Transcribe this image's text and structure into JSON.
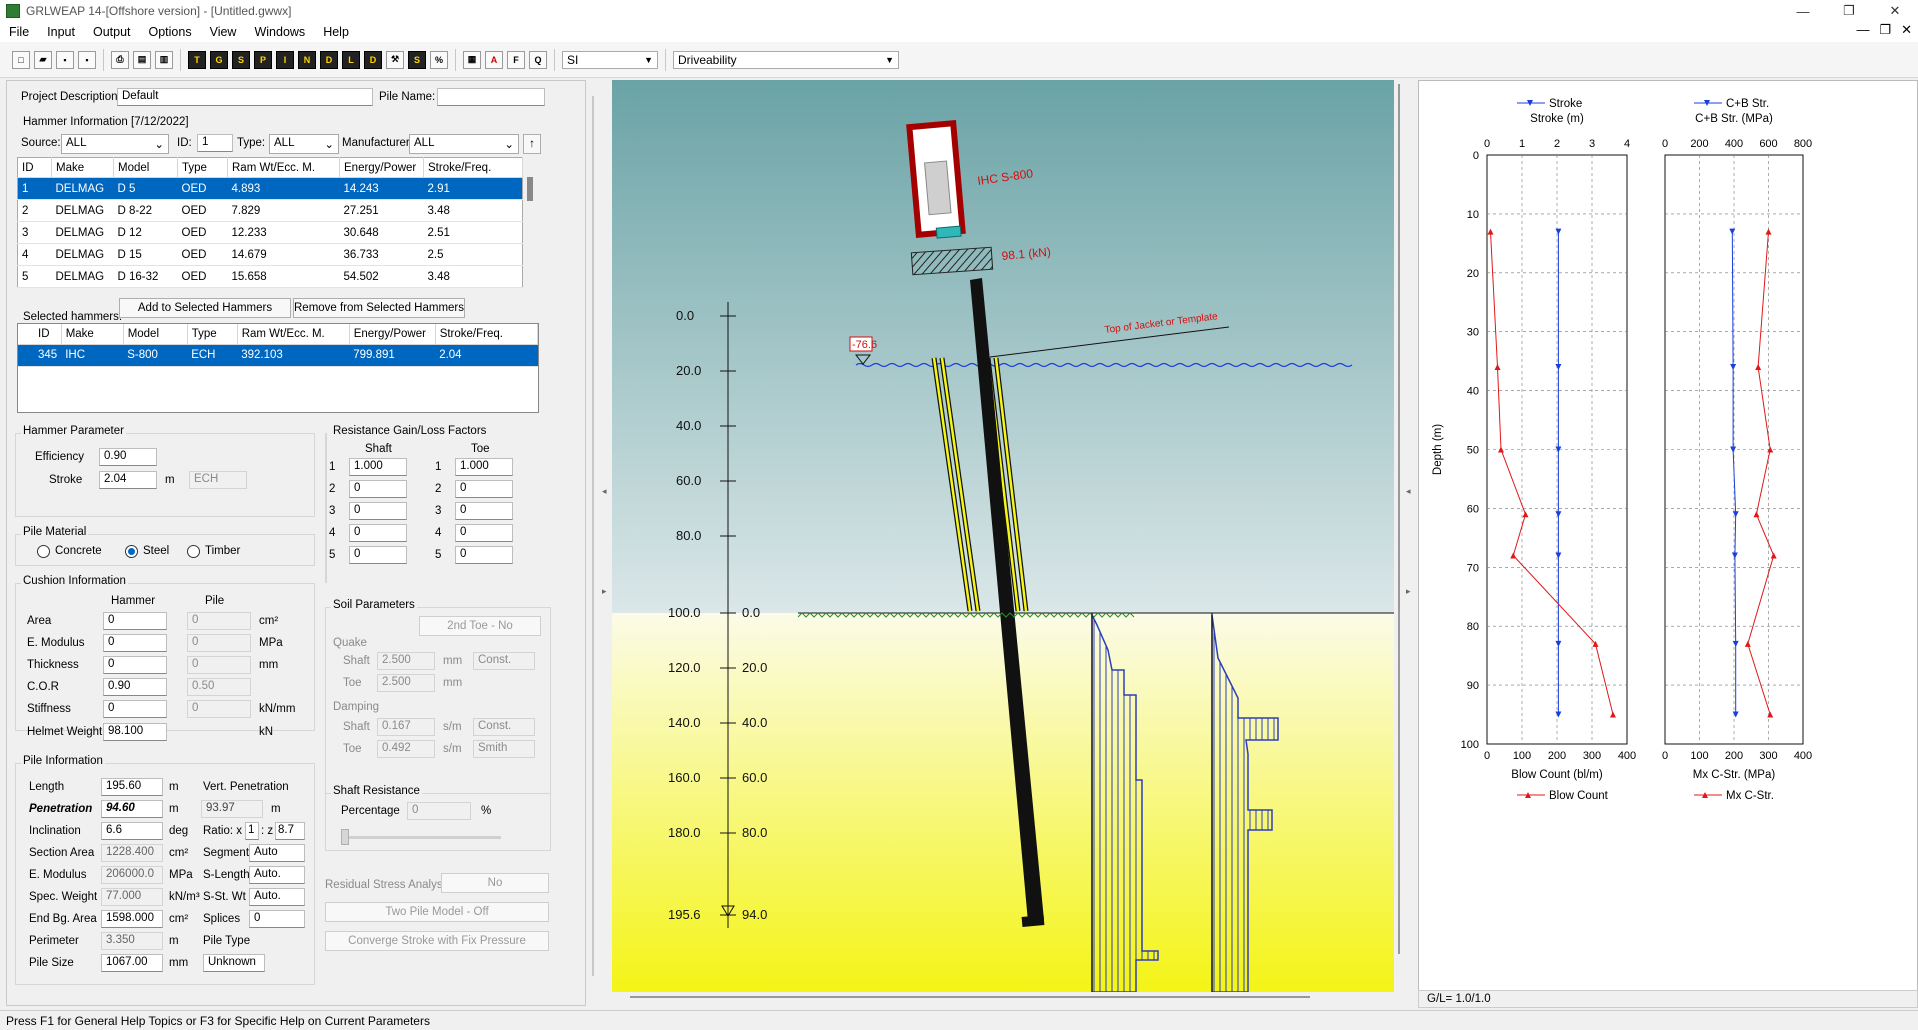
{
  "window": {
    "title": "GRLWEAP 14-[Offshore version]  - [Untitled.gwwx]",
    "min": "—",
    "max": "❐",
    "close": "✕"
  },
  "menu": [
    "File",
    "Input",
    "Output",
    "Options",
    "View",
    "Windows",
    "Help"
  ],
  "toolbar": {
    "units": "SI",
    "mode": "Driveability"
  },
  "status": "Press F1 for General Help Topics or F3 for Specific Help on Current Parameters",
  "project": {
    "desc_label": "Project Description:",
    "desc_value": "Default",
    "pile_name_label": "Pile Name:",
    "pile_name_value": ""
  },
  "hammer_info": {
    "title": "Hammer Information [7/12/2022]",
    "source_label": "Source:",
    "source": "ALL",
    "id_label": "ID:",
    "id": "1",
    "type_label": "Type:",
    "type": "ALL",
    "manufacturer_label": "Manufacturer:",
    "manufacturer": "ALL",
    "headers": [
      "ID",
      "Make",
      "Model",
      "Type",
      "Ram Wt/Ecc. M.",
      "Energy/Power",
      "Stroke/Freq."
    ],
    "rows": [
      [
        "1",
        "DELMAG",
        "D 5",
        "OED",
        "4.893",
        "14.243",
        "2.91"
      ],
      [
        "2",
        "DELMAG",
        "D 8-22",
        "OED",
        "7.829",
        "27.251",
        "3.48"
      ],
      [
        "3",
        "DELMAG",
        "D 12",
        "OED",
        "12.233",
        "30.648",
        "2.51"
      ],
      [
        "4",
        "DELMAG",
        "D 15",
        "OED",
        "14.679",
        "36.733",
        "2.5"
      ],
      [
        "5",
        "DELMAG",
        "D 16-32",
        "OED",
        "15.658",
        "54.502",
        "3.48"
      ]
    ]
  },
  "selected": {
    "label": "Selected hammers:",
    "add_btn": "Add to Selected Hammers",
    "remove_btn": "Remove from Selected Hammers",
    "headers": [
      "ID",
      "Make",
      "Model",
      "Type",
      "Ram Wt/Ecc. M.",
      "Energy/Power",
      "Stroke/Freq."
    ],
    "rows": [
      [
        "345",
        "IHC",
        "S-800",
        "ECH",
        "392.103",
        "799.891",
        "2.04"
      ]
    ]
  },
  "hammer_param": {
    "title": "Hammer Parameter",
    "eff_label": "Efficiency",
    "eff": "0.90",
    "stroke_label": "Stroke",
    "stroke": "2.04",
    "stroke_unit": "m",
    "type": "ECH"
  },
  "pile_material": {
    "title": "Pile Material",
    "options": [
      "Concrete",
      "Steel",
      "Timber"
    ],
    "selected": "Steel"
  },
  "cushion": {
    "title": "Cushion Information",
    "col_hammer": "Hammer",
    "col_pile": "Pile",
    "rows": [
      {
        "label": "Area",
        "hammer": "0",
        "pile": "0",
        "unit": "cm²"
      },
      {
        "label": "E. Modulus",
        "hammer": "0",
        "pile": "0",
        "unit": "MPa"
      },
      {
        "label": "Thickness",
        "hammer": "0",
        "pile": "0",
        "unit": "mm"
      },
      {
        "label": "C.O.R",
        "hammer": "0.90",
        "pile": "0.50",
        "unit": ""
      },
      {
        "label": "Stiffness",
        "hammer": "0",
        "pile": "0",
        "unit": "kN/mm"
      }
    ],
    "helmet_label": "Helmet Weight",
    "helmet": "98.100",
    "helmet_unit": "kN"
  },
  "pile_info": {
    "title": "Pile Information",
    "length_label": "Length",
    "length": "195.60",
    "length_unit": "m",
    "vert_label": "Vert. Penetration",
    "pen_label": "Penetration",
    "pen": "94.60",
    "pen_unit": "m",
    "vert": "93.97",
    "vert_unit": "m",
    "incl_label": "Inclination",
    "incl": "6.6",
    "incl_unit": "deg",
    "ratio_label": "Ratio: x",
    "ratio_x": "1",
    "ratio_z_label": ": z",
    "ratio_z": "8.7",
    "area_label": "Section Area",
    "area": "1228.400",
    "area_unit": "cm²",
    "seg_label": "Segments",
    "seg": "Auto",
    "emod_label": "E. Modulus",
    "emod": "206000.0",
    "emod_unit": "MPa",
    "slen_label": "S-Length",
    "slen": "Auto.",
    "sw_label": "Spec. Weight",
    "sw": "77.000",
    "sw_unit": "kN/m³",
    "sst_label": "S-St. Wt",
    "sst": "Auto.",
    "eb_label": "End Bg. Area",
    "eb": "1598.000",
    "eb_unit": "cm²",
    "spl_label": "Splices",
    "spl": "0",
    "per_label": "Perimeter",
    "per": "3.350",
    "per_unit": "m",
    "ptype_label": "Pile Type",
    "size_label": "Pile Size",
    "size": "1067.00",
    "size_unit": "mm",
    "ptype": "Unknown"
  },
  "resistance": {
    "title": "Resistance Gain/Loss Factors",
    "shaft_label": "Shaft",
    "toe_label": "Toe",
    "shaft": [
      "1.000",
      "0",
      "0",
      "0",
      "0"
    ],
    "toe": [
      "1.000",
      "0",
      "0",
      "0",
      "0"
    ],
    "idx": [
      "1",
      "2",
      "3",
      "4",
      "5"
    ]
  },
  "soil": {
    "title": "Soil Parameters",
    "toe2": "2nd Toe - No",
    "quake_label": "Quake",
    "shaft_label": "Shaft",
    "toe_label": "Toe",
    "q_shaft": "2.500",
    "q_toe": "2.500",
    "q_unit": "mm",
    "q_method": "Const.",
    "damp_label": "Damping",
    "d_shaft": "0.167",
    "d_toe": "0.492",
    "d_unit": "s/m",
    "d_method_shaft": "Const.",
    "d_method_toe": "Smith"
  },
  "shaft_res": {
    "title": "Shaft Resistance",
    "pct_label": "Percentage",
    "pct": "0",
    "pct_unit": "%"
  },
  "buttons": {
    "residual_label": "Residual Stress Analysis",
    "residual": "No",
    "two_pile": "Two Pile Model - Off",
    "converge": "Converge Stroke with Fix Pressure"
  },
  "drawing": {
    "hammer_label": "IHC  S-800",
    "helmet_label": "98.1 (kN)",
    "jacket_label": "Top of Jacket or Template",
    "water_label": "-76.6",
    "left_ticks": [
      "0.0",
      "20.0",
      "40.0",
      "60.0",
      "80.0",
      "100.0",
      "120.0",
      "140.0",
      "160.0",
      "180.0",
      "195.6"
    ],
    "right_ticks": [
      "0.0",
      "20.0",
      "40.0",
      "60.0",
      "80.0",
      "94.0"
    ]
  },
  "charts": {
    "gl": "G/L= 1.0/1.0",
    "left": {
      "top_legend": "Stroke",
      "top_axis": "Stroke (m)",
      "top_ticks": [
        "0",
        "1",
        "2",
        "3",
        "4"
      ],
      "bottom_axis": "Blow Count (bl/m)",
      "bottom_ticks": [
        "0",
        "100",
        "200",
        "300",
        "400"
      ],
      "bottom_legend": "Blow Count",
      "y_label": "Depth (m)",
      "y_ticks": [
        "0",
        "10",
        "20",
        "30",
        "40",
        "50",
        "60",
        "70",
        "80",
        "90",
        "100"
      ]
    },
    "right": {
      "top_legend": "C+B Str.",
      "top_axis": "C+B Str. (MPa)",
      "top_ticks": [
        "0",
        "200",
        "400",
        "600",
        "800"
      ],
      "bottom_axis": "Mx C-Str. (MPa)",
      "bottom_ticks": [
        "0",
        "100",
        "200",
        "300",
        "400"
      ],
      "bottom_legend": "Mx C-Str."
    }
  },
  "chart_data": [
    {
      "type": "line",
      "y_axis": "Depth (m)",
      "ylim": [
        0,
        100
      ],
      "y_reversed": true,
      "series": [
        {
          "name": "Stroke",
          "axis": "top",
          "xlim": [
            0,
            4
          ],
          "color": "#1a3fdc",
          "x": [
            2.04,
            2.04,
            2.04,
            2.04,
            2.04,
            2.04,
            2.04
          ],
          "y": [
            13,
            36,
            50,
            61,
            68,
            83,
            95
          ]
        },
        {
          "name": "Blow Count",
          "axis": "bottom",
          "xlim": [
            0,
            400
          ],
          "color": "#e01818",
          "x": [
            10,
            30,
            40,
            110,
            75,
            310,
            360
          ],
          "y": [
            13,
            36,
            50,
            61,
            68,
            83,
            95
          ]
        }
      ]
    },
    {
      "type": "line",
      "y_axis": "Depth (m)",
      "ylim": [
        0,
        100
      ],
      "y_reversed": true,
      "series": [
        {
          "name": "C+B Str.",
          "axis": "top",
          "xlim": [
            0,
            800
          ],
          "color": "#1a3fdc",
          "x": [
            390,
            395,
            395,
            410,
            405,
            410,
            410
          ],
          "y": [
            13,
            36,
            50,
            61,
            68,
            83,
            95
          ]
        },
        {
          "name": "Mx C-Str.",
          "axis": "bottom",
          "xlim": [
            0,
            400
          ],
          "color": "#e01818",
          "x": [
            300,
            270,
            305,
            265,
            315,
            240,
            305
          ],
          "y": [
            13,
            36,
            50,
            61,
            68,
            83,
            95
          ]
        }
      ]
    }
  ]
}
